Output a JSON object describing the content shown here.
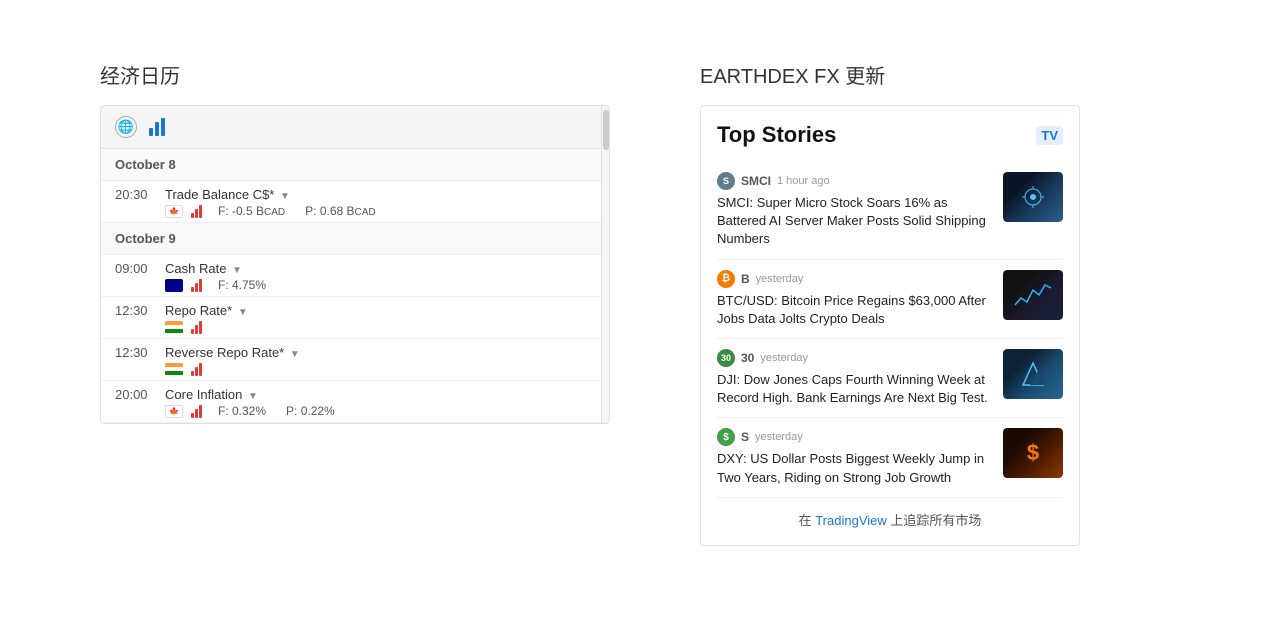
{
  "left": {
    "section_title": "经济日历",
    "dates": [
      {
        "label": "October 8",
        "events": [
          {
            "time": "20:30",
            "name": "Trade Balance C$*",
            "country": "CA",
            "impact": "high",
            "forecast": "F: -0.5 BCAD",
            "previous": "P: 0.68 BCAD"
          }
        ]
      },
      {
        "label": "October 9",
        "events": [
          {
            "time": "09:00",
            "name": "Cash Rate",
            "country": "AU",
            "impact": "high",
            "forecast": "F: 4.75%",
            "previous": ""
          },
          {
            "time": "12:30",
            "name": "Repo Rate*",
            "country": "IN",
            "impact": "high",
            "forecast": "",
            "previous": ""
          },
          {
            "time": "12:30",
            "name": "Reverse Repo Rate*",
            "country": "IN",
            "impact": "high",
            "forecast": "",
            "previous": ""
          },
          {
            "time": "20:00",
            "name": "Core Inflation",
            "country": "CA",
            "impact": "high",
            "forecast": "F: 0.32%",
            "previous": "P: 0.22%"
          }
        ]
      }
    ]
  },
  "right": {
    "section_title": "EARTHDEX FX 更新",
    "widget_title": "Top Stories",
    "tv_logo": "TV",
    "news": [
      {
        "source": "SMCI",
        "source_color": "#607d8b",
        "source_initial": "S",
        "time": "1 hour ago",
        "headline": "SMCI: Super Micro Stock Soars 16% as Battered AI Server Maker Posts Solid Shipping Numbers",
        "thumb_type": "ai"
      },
      {
        "source": "B",
        "source_color": "#f57c00",
        "source_initial": "B",
        "time": "yesterday",
        "headline": "BTC/USD: Bitcoin Price Regains $63,000 After Jobs Data Jolts Crypto Deals",
        "thumb_type": "btc"
      },
      {
        "source": "30",
        "source_color": "#388e3c",
        "source_initial": "30",
        "time": "yesterday",
        "headline": "DJI: Dow Jones Caps Fourth Winning Week at Record High. Bank Earnings Are Next Big Test.",
        "thumb_type": "dji"
      },
      {
        "source": "S",
        "source_color": "#43a047",
        "source_initial": "S",
        "time": "yesterday",
        "headline": "DXY: US Dollar Posts Biggest Weekly Jump in Two Years, Riding on Strong Job Growth",
        "thumb_type": "dxy"
      }
    ],
    "footer_text": "在 TradingView 上追踪所有市场",
    "footer_link": "TradingView"
  }
}
